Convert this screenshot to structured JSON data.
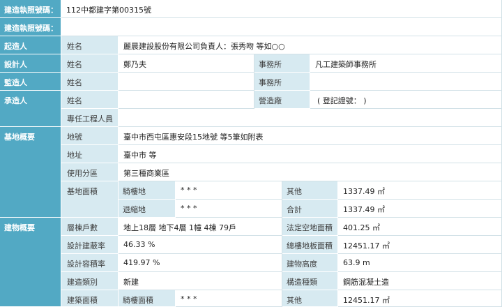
{
  "permit": {
    "no_label": "建造執照號碼：",
    "no_value": "112中都建字第00315號",
    "change_label": "建造執照號碼：",
    "change_value": ""
  },
  "parties": {
    "builder": {
      "title": "起造人",
      "name_label": "姓名",
      "name_value": "麗晨建設股份有限公司負責人：張秀吻 等如○○"
    },
    "designer": {
      "title": "設計人",
      "name_label": "姓名",
      "name_value": "鄭乃夫",
      "office_label": "事務所",
      "office_value": "凡工建築師事務所"
    },
    "supervisor": {
      "title": "監造人",
      "name_label": "姓名",
      "name_value": "",
      "office_label": "事務所",
      "office_value": ""
    },
    "contractor": {
      "title": "承造人",
      "name_label": "姓名",
      "name_value": "",
      "factory_label": "營造廠",
      "factory_value": "( 登記證號： )",
      "engineer_label": "專任工程人員",
      "engineer_value": ""
    }
  },
  "site": {
    "title": "基地概要",
    "lot_label": "地號",
    "lot_value": "臺中市西屯區惠安段15地號 等5筆如附表",
    "address_label": "地址",
    "address_value": "臺中市 等",
    "zone_label": "使用分區",
    "zone_value": "第三種商業區",
    "area_label": "基地面積",
    "arcade_label": "騎樓地",
    "arcade_value": "* * *",
    "other_label": "其他",
    "other_value": "1337.49 ㎡",
    "setback_label": "退縮地",
    "setback_value": "* * *",
    "total_label": "合計",
    "total_value": "1337.49 ㎡"
  },
  "building": {
    "title": "建物概要",
    "floors_label": "層棟戶數",
    "floors_value": "地上18層 地下4層 1幢 4棟 79戶",
    "openspace_label": "法定空地面積",
    "openspace_value": "401.25 ㎡",
    "coverage_label": "設計建蔽率",
    "coverage_value": "46.33 %",
    "floorarea_label": "總樓地板面積",
    "floorarea_value": "12451.17 ㎡",
    "far_label": "設計容積率",
    "far_value": "419.97 %",
    "height_label": "建物高度",
    "height_value": "63.9 m",
    "type_label": "建造類別",
    "type_value": "新建",
    "structure_label": "構造種類",
    "structure_value": "鋼筋混凝土造",
    "bldgarea_label": "建築面積",
    "arcadearea_label": "騎樓面積",
    "arcadearea_value": "* * *",
    "other_label": "其他",
    "other_value": "12451.17 ㎡"
  }
}
